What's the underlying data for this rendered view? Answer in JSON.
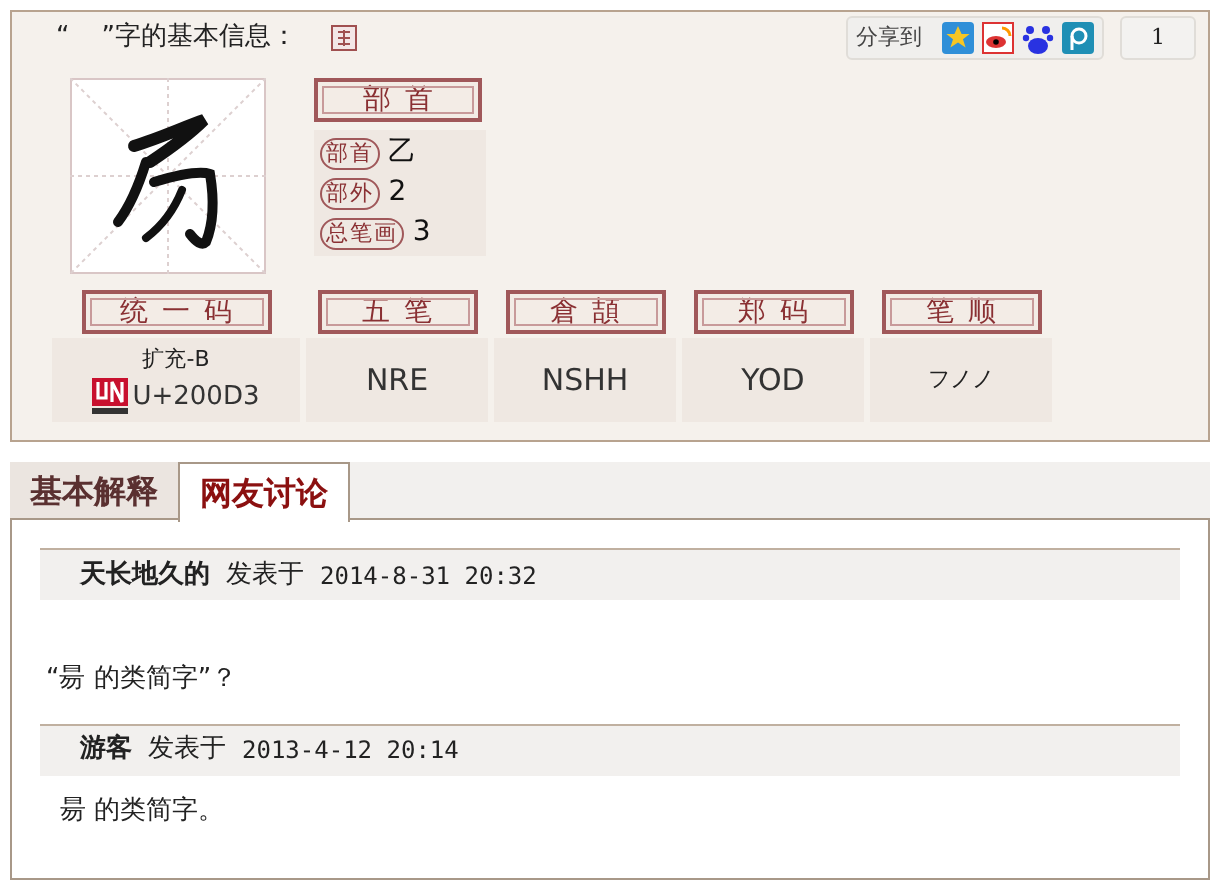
{
  "title": {
    "open_quote": "“",
    "text": "”字的基本信息："
  },
  "share": {
    "label": "分享到",
    "count": "1"
  },
  "radical": {
    "heading": "部首",
    "rows": [
      {
        "label": "部首",
        "value": "乙"
      },
      {
        "label": "部外",
        "value": "2"
      },
      {
        "label": "总笔画",
        "value": "3"
      }
    ]
  },
  "codes": [
    {
      "heading": "统一码",
      "kind": "unicode",
      "lines": [
        "扩充-B",
        "U+200D3"
      ]
    },
    {
      "heading": "五笔",
      "kind": "plain",
      "lines": [
        "NRE"
      ]
    },
    {
      "heading": "倉頡",
      "kind": "plain",
      "lines": [
        "NSHH"
      ]
    },
    {
      "heading": "郑码",
      "kind": "plain",
      "lines": [
        "YOD"
      ]
    },
    {
      "heading": "笔顺",
      "kind": "small",
      "lines": [
        "フノノ"
      ]
    }
  ],
  "tabs": [
    {
      "label": "基本解释",
      "selected": false
    },
    {
      "label": "网友讨论",
      "selected": true
    }
  ],
  "posts": [
    {
      "author": "天长地久的",
      "verb": "发表于",
      "time": "2014-8-31 20:32",
      "body": "“昜 的类简字”？",
      "kind": "spaced"
    },
    {
      "author": "游客",
      "verb": "发表于",
      "time": "2013-4-12 20:14",
      "body": "昜 的类简字。",
      "kind": "tight"
    }
  ]
}
